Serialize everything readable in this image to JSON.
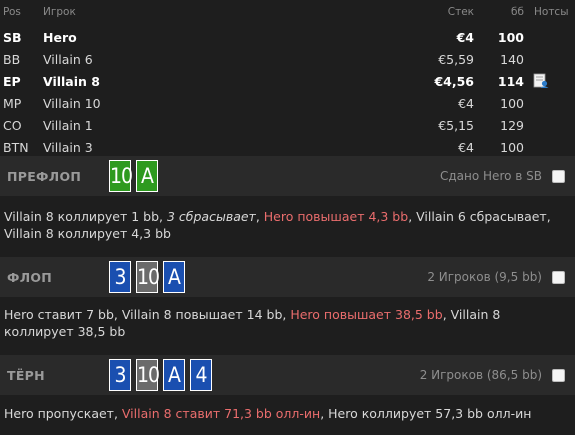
{
  "table": {
    "headers": {
      "pos": "Pos",
      "player": "Игрок",
      "stack": "Стек",
      "bb": "бб",
      "notes": "Нотсы"
    },
    "players": [
      {
        "pos": "SB",
        "name": "Hero",
        "stack": "€4",
        "bb": "100",
        "bold": true,
        "note": false
      },
      {
        "pos": "BB",
        "name": "Villain 6",
        "stack": "€5,59",
        "bb": "140",
        "bold": false,
        "note": false
      },
      {
        "pos": "EP",
        "name": "Villain 8",
        "stack": "€4,56",
        "bb": "114",
        "bold": true,
        "note": true
      },
      {
        "pos": "MP",
        "name": "Villain 10",
        "stack": "€4",
        "bb": "100",
        "bold": false,
        "note": false
      },
      {
        "pos": "CO",
        "name": "Villain 1",
        "stack": "€5,15",
        "bb": "129",
        "bold": false,
        "note": false
      },
      {
        "pos": "BTN",
        "name": "Villain 3",
        "stack": "€4",
        "bb": "100",
        "bold": false,
        "note": false
      }
    ]
  },
  "streets": {
    "preflop": {
      "name": "ПРЕФЛОП",
      "info": "Сдано Hero в SB",
      "cards": [
        {
          "rank": "10",
          "suit": "club"
        },
        {
          "rank": "A",
          "suit": "club"
        }
      ],
      "actions": [
        {
          "text": "Villain 8 коллирует 1 bb, ",
          "style": "normal"
        },
        {
          "text": "3 сбрасывает",
          "style": "ital"
        },
        {
          "text": ", ",
          "style": "normal"
        },
        {
          "text": "Hero повышает 4,3 bb",
          "style": "hero"
        },
        {
          "text": ", Villain 6 сбрасывает, Villain 8 коллирует 4,3 bb",
          "style": "normal"
        }
      ]
    },
    "flop": {
      "name": "ФЛОП",
      "info": "2 Игроков (9,5 bb)",
      "cards": [
        {
          "rank": "3",
          "suit": "diamond"
        },
        {
          "rank": "10",
          "suit": "spade"
        },
        {
          "rank": "A",
          "suit": "diamond"
        }
      ],
      "actions": [
        {
          "text": "Hero ставит 7 bb, Villain 8 повышает 14 bb, ",
          "style": "normal"
        },
        {
          "text": "Hero повышает 38,5 bb",
          "style": "hero"
        },
        {
          "text": ", Villain 8 коллирует 38,5 bb",
          "style": "normal"
        }
      ]
    },
    "turn": {
      "name": "ТЁРН",
      "info": "2 Игроков (86,5 bb)",
      "cards": [
        {
          "rank": "3",
          "suit": "diamond"
        },
        {
          "rank": "10",
          "suit": "spade"
        },
        {
          "rank": "A",
          "suit": "diamond"
        },
        {
          "rank": "4",
          "suit": "diamond"
        }
      ],
      "actions": [
        {
          "text": "Hero пропускает, ",
          "style": "normal"
        },
        {
          "text": "Villain 8 ставит 71,3 bb олл-ин",
          "style": "hero"
        },
        {
          "text": ", Hero коллирует 57,3 bb олл-ин",
          "style": "normal"
        }
      ]
    }
  }
}
